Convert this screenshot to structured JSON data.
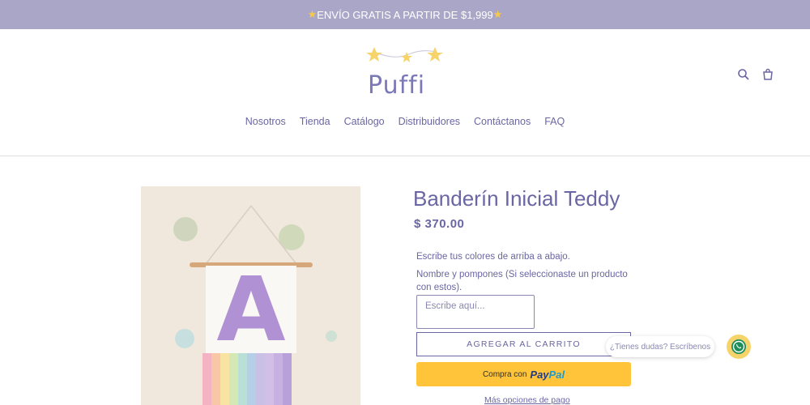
{
  "announcement": {
    "text": "ENVÍO GRATIS A PARTIR DE $1,999"
  },
  "brand": {
    "name": "Puffi"
  },
  "nav": {
    "items": [
      "Nosotros",
      "Tienda",
      "Catálogo",
      "Distribuidores",
      "Contáctanos",
      "FAQ"
    ]
  },
  "product": {
    "title": "Banderín Inicial Teddy",
    "price": "$ 370.00",
    "image_letter": "A",
    "instructions": "Escribe tus colores de arriba a abajo.",
    "field_label": "Nombre y pompones (Si seleccionaste un producto con estos).",
    "textarea_placeholder": "Escribe aquí...",
    "add_to_cart": "AGREGAR AL CARRITO",
    "paypal_prefix": "Compra con",
    "paypal_brand_1": "Pay",
    "paypal_brand_2": "Pal",
    "more_options": "Más opciones de pago"
  },
  "whatsapp": {
    "bubble": "¿Tienes dudas? Escríbenos"
  },
  "icons": {
    "search": "search-icon",
    "cart": "cart-icon",
    "whatsapp": "whatsapp-icon",
    "star": "star-icon"
  },
  "colors": {
    "accent": "#6a66a3",
    "announce_bg": "#a9a6c8",
    "paypal": "#ffc439",
    "star": "#f7c948"
  }
}
